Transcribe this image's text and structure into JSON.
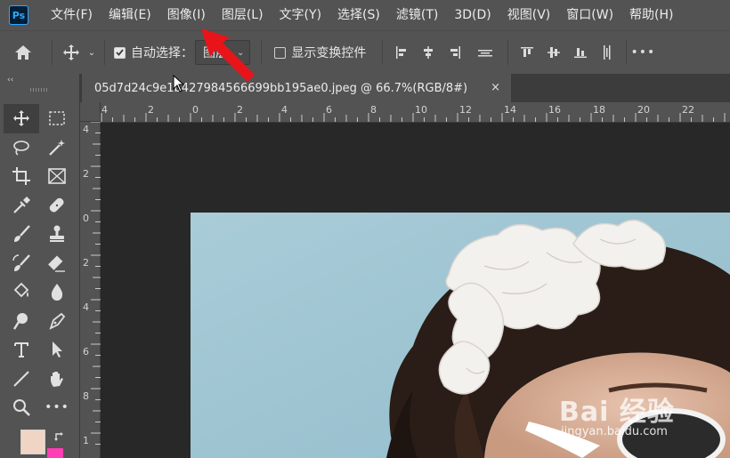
{
  "app": {
    "logo": "Ps"
  },
  "menu": [
    "文件(F)",
    "编辑(E)",
    "图像(I)",
    "图层(L)",
    "文字(Y)",
    "选择(S)",
    "滤镜(T)",
    "3D(D)",
    "视图(V)",
    "窗口(W)",
    "帮助(H)"
  ],
  "options": {
    "auto_select_label": "自动选择：",
    "auto_select_checked": true,
    "layer_select_value": "图层",
    "show_transform_label": "显示变换控件",
    "show_transform_checked": false
  },
  "document": {
    "tab_title": "05d7d24c9e1b427984566699bb195ae0.jpeg @ 66.7%(RGB/8#)",
    "close_glyph": "×"
  },
  "ruler": {
    "top_labels": [
      "4",
      "2",
      "0",
      "2",
      "4",
      "6",
      "8",
      "10",
      "12",
      "14",
      "16",
      "18",
      "20",
      "22"
    ],
    "left_labels": [
      "4",
      "2",
      "0",
      "2",
      "4",
      "6",
      "8",
      "1"
    ]
  },
  "colors": {
    "foreground": "#f1d5c4",
    "background": "#ff3eb5",
    "ui_panel": "#535353",
    "canvas_bg": "#282828"
  },
  "watermark": {
    "main": "Bai 经验",
    "sub": "jingyan.baidu.com"
  },
  "annotation": {
    "type": "red-arrow",
    "points_to": "图像(I)"
  }
}
